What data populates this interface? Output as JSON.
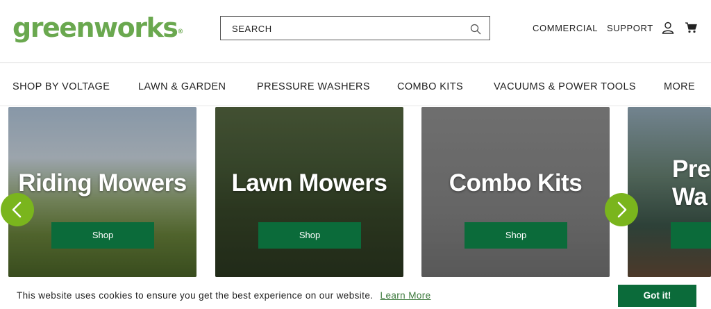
{
  "header": {
    "logo_main": "greenworks",
    "logo_mark": "®",
    "search_placeholder": "SEARCH",
    "links": [
      "COMMERCIAL",
      "SUPPORT"
    ],
    "icons": [
      "search-icon",
      "user-icon",
      "cart-icon"
    ]
  },
  "nav": {
    "items": [
      "SHOP BY VOLTAGE",
      "LAWN & GARDEN",
      "PRESSURE WASHERS",
      "COMBO KITS",
      "VACUUMS & POWER TOOLS",
      "MORE"
    ]
  },
  "carousel": {
    "cards": [
      {
        "title": "Riding Mowers",
        "button": "Shop"
      },
      {
        "title": "Lawn Mowers",
        "button": "Shop"
      },
      {
        "title": "Combo Kits",
        "button": "Shop"
      },
      {
        "title_line1": "Pre",
        "title_line2": "Wa"
      }
    ],
    "icons": [
      "chevron-left-icon",
      "chevron-right-icon"
    ]
  },
  "cookie": {
    "message": "This website uses cookies to ensure you get the best experience on our website.",
    "link": "Learn More",
    "button": "Got it!"
  },
  "colors": {
    "brand_green": "#6aa84f",
    "button_green": "#0b6b3a",
    "arrow_green": "#7ab51d"
  }
}
